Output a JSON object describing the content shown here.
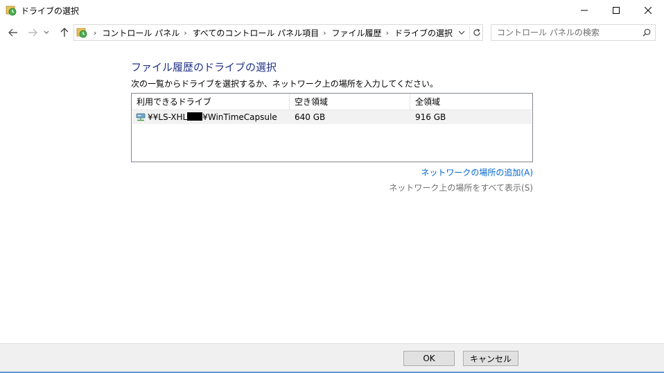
{
  "window": {
    "title": "ドライブの選択",
    "title_icon": "file-history-icon"
  },
  "navigation": {
    "back_icon": "back-arrow-icon",
    "forward_icon": "forward-arrow-icon",
    "recent_icon": "chevron-down-icon",
    "up_icon": "up-arrow-icon",
    "breadcrumbs": [
      "コントロール パネル",
      "すべてのコントロール パネル項目",
      "ファイル履歴",
      "ドライブの選択"
    ],
    "refresh_icon": "refresh-icon"
  },
  "search": {
    "placeholder": "コントロール パネルの検索",
    "value": ""
  },
  "main": {
    "heading": "ファイル履歴のドライブの選択",
    "instruction": "次の一覧からドライブを選択するか、ネットワーク上の場所を入力してください。"
  },
  "drive_list": {
    "columns": [
      "利用できるドライブ",
      "空き領域",
      "全領域"
    ],
    "rows": [
      {
        "name_prefix": "¥¥LS-XHL",
        "name_suffix": "¥WinTimeCapsule",
        "free": "640 GB",
        "total": "916 GB",
        "icon": "network-drive-icon"
      }
    ]
  },
  "links": {
    "add_network": "ネットワークの場所の追加(A)",
    "show_all": "ネットワーク上の場所をすべて表示(S)"
  },
  "buttons": {
    "ok": "OK",
    "cancel": "キャンセル"
  },
  "colors": {
    "heading": "#1e3287",
    "link": "#0066cc",
    "disabled_link": "#6d6d6d",
    "accent_strip": "#5b9bd5"
  }
}
